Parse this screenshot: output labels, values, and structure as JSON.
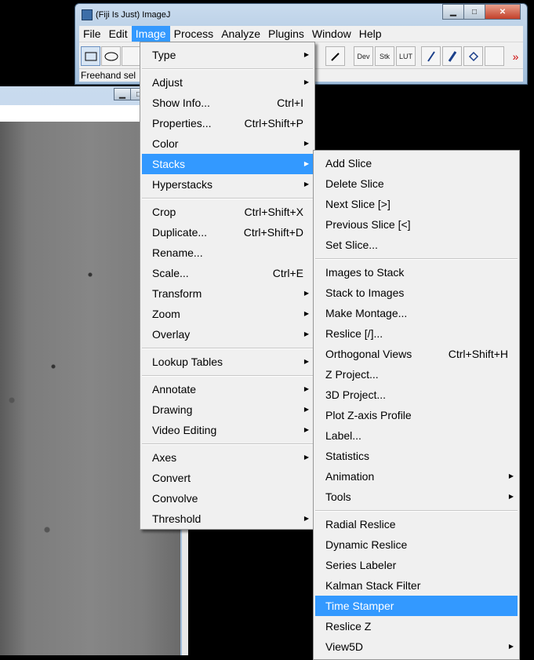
{
  "window": {
    "title": "(Fiji Is Just) ImageJ"
  },
  "menubar": [
    "File",
    "Edit",
    "Image",
    "Process",
    "Analyze",
    "Plugins",
    "Window",
    "Help"
  ],
  "toolbar": {
    "dev": "Dev",
    "stk": "Stk",
    "lut": "LUT",
    "more": "»"
  },
  "status": "Freehand sel",
  "image_menu": [
    {
      "label": "Type",
      "sub": true
    },
    {
      "sep": true
    },
    {
      "label": "Adjust",
      "sub": true
    },
    {
      "label": "Show Info...",
      "shortcut": "Ctrl+I"
    },
    {
      "label": "Properties...",
      "shortcut": "Ctrl+Shift+P"
    },
    {
      "label": "Color",
      "sub": true
    },
    {
      "label": "Stacks",
      "sub": true,
      "hl": true
    },
    {
      "label": "Hyperstacks",
      "sub": true
    },
    {
      "sep": true
    },
    {
      "label": "Crop",
      "shortcut": "Ctrl+Shift+X"
    },
    {
      "label": "Duplicate...",
      "shortcut": "Ctrl+Shift+D"
    },
    {
      "label": "Rename..."
    },
    {
      "label": "Scale...",
      "shortcut": "Ctrl+E"
    },
    {
      "label": "Transform",
      "sub": true
    },
    {
      "label": "Zoom",
      "sub": true
    },
    {
      "label": "Overlay",
      "sub": true
    },
    {
      "sep": true
    },
    {
      "label": "Lookup Tables",
      "sub": true
    },
    {
      "sep": true
    },
    {
      "label": "Annotate",
      "sub": true
    },
    {
      "label": "Drawing",
      "sub": true
    },
    {
      "label": "Video Editing",
      "sub": true
    },
    {
      "sep": true
    },
    {
      "label": "Axes",
      "sub": true
    },
    {
      "label": "Convert"
    },
    {
      "label": "Convolve"
    },
    {
      "label": "Threshold",
      "sub": true
    }
  ],
  "stacks_menu": [
    {
      "label": "Add Slice"
    },
    {
      "label": "Delete Slice"
    },
    {
      "label": "Next Slice [>]"
    },
    {
      "label": "Previous Slice [<]"
    },
    {
      "label": "Set Slice..."
    },
    {
      "sep": true
    },
    {
      "label": "Images to Stack"
    },
    {
      "label": "Stack to Images"
    },
    {
      "label": "Make Montage..."
    },
    {
      "label": "Reslice [/]..."
    },
    {
      "label": "Orthogonal Views",
      "shortcut": "Ctrl+Shift+H"
    },
    {
      "label": "Z Project..."
    },
    {
      "label": "3D Project..."
    },
    {
      "label": "Plot Z-axis Profile"
    },
    {
      "label": "Label..."
    },
    {
      "label": "Statistics"
    },
    {
      "label": "Animation",
      "sub": true
    },
    {
      "label": "Tools",
      "sub": true
    },
    {
      "sep": true
    },
    {
      "label": "Radial Reslice"
    },
    {
      "label": "Dynamic Reslice"
    },
    {
      "label": "Series Labeler"
    },
    {
      "label": "Kalman Stack Filter"
    },
    {
      "label": "Time Stamper",
      "hl": true
    },
    {
      "label": "Reslice Z"
    },
    {
      "label": "View5D",
      "sub": true
    }
  ],
  "colors": {
    "highlight": "#3399ff",
    "menu_bg": "#f0f0f0"
  }
}
